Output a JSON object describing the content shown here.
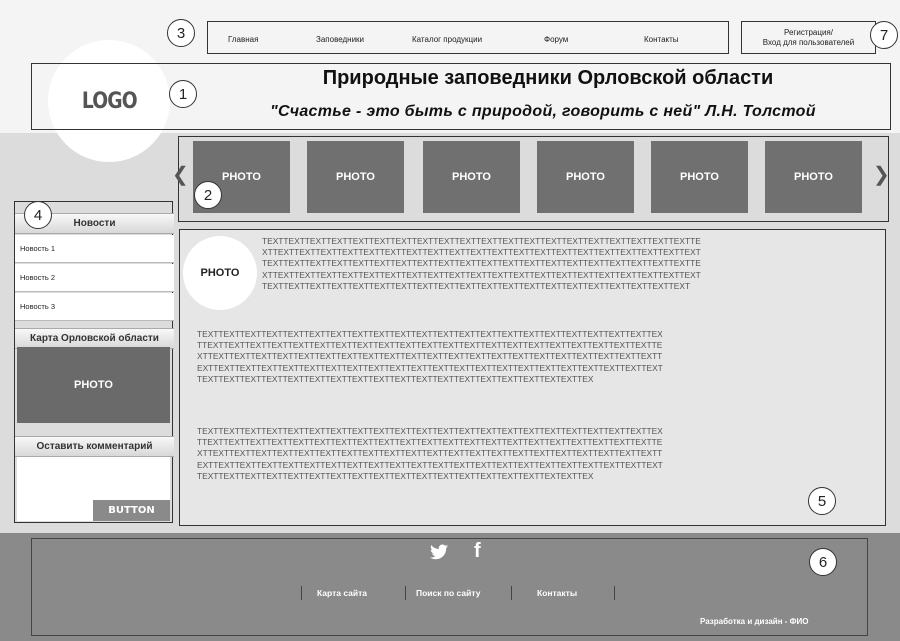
{
  "nav": {
    "items": [
      "Главная",
      "Заповедники",
      "Каталог продукции",
      "Форум",
      "Контакты"
    ],
    "login": [
      "Регистрация/",
      "Вход для пользователей"
    ]
  },
  "markers": [
    "1",
    "2",
    "3",
    "4",
    "5",
    "6",
    "7"
  ],
  "header": {
    "logo": "LOGO",
    "title": "Природные заповедники Орловской области",
    "quote": "\"Счастье - это быть с природой, говорить с ней\" Л.Н. Толстой"
  },
  "gallery": {
    "photos": [
      "PHOTO",
      "PHOTO",
      "PHOTO",
      "PHOTO",
      "PHOTO",
      "PHOTO"
    ],
    "prev_arrow": "❮",
    "next_arrow": "❯"
  },
  "sidebar": {
    "news_heading": "Новости",
    "news_items": [
      "Новость 1",
      "Новость 2",
      "Новость 3"
    ],
    "map_heading": "Карта Орловской области",
    "map_photo": "PHOTO",
    "comment_heading": "Оставить комментарий",
    "button": "BUTTON"
  },
  "content": {
    "photo": "PHOTO",
    "para1_lines": [
      "TEXTTEXTTEXTTEXTTEXTTEXTTEXTTEXTTEXTTEXTTEXTTEXTTEXTTEXTTEXTTEXTTEXTTEXTTEXTTEXTTE",
      "XTTEXTTEXTTEXTTEXTTEXTTEXTTEXTTEXTTEXTTEXTTEXTTEXTTEXTTEXTTEXTTEXTTEXTTEXTTEXTTEXT",
      "TEXTTEXTTEXTTEXTTEXTTEXTTEXTTEXTTEXTTEXTTEXTTEXTTEXTTEXTTEXTTEXTTEXTTEXTTEXTTEXTTE",
      "XTTEXTTEXTTEXTTEXTTEXTTEXTTEXTTEXTTEXTTEXTTEXTTEXTTEXTTEXTTEXTTEXTTEXTTEXTTEXTTEXT",
      "TEXTTEXTTEXTTEXTTEXTTEXTTEXTTEXTTEXTTEXTTEXTTEXTTEXTTEXTTEXTTEXTTEXTTEXTTEXTTEXT"
    ],
    "para2_lines": [
      "TEXTTEXTTEXTTEXTTEXTTEXTTEXTTEXTTEXTTEXTTEXTTEXTTEXTTEXTTEXTTEXTTEXTTEXTTEXTTEXTTEXTTEX",
      "TTEXTTEXTTEXTTEXTTEXTTEXTTEXTTEXTTEXTTEXTTEXTTEXTTEXTTEXTTEXTTEXTTEXTTEXTTEXTTEXTTEXTTE",
      "XTTEXTTEXTTEXTTEXTTEXTTEXTTEXTTEXTTEXTTEXTTEXTTEXTTEXTTEXTTEXTTEXTTEXTTEXTTEXTTEXTTEXTT",
      "EXTTEXTTEXTTEXTTEXTTEXTTEXTTEXTTEXTTEXTTEXTTEXTTEXTTEXTTEXTTEXTTEXTTEXTTEXTTEXTTEXTTEXT",
      "TEXTTEXTTEXTTEXTTEXTTEXTTEXTTEXTTEXTTEXTTEXTTEXTTEXTTEXTTEXTTEXTTEXTEXTTEX"
    ],
    "para3_lines": [
      "TEXTTEXTTEXTTEXTTEXTTEXTTEXTTEXTTEXTTEXTTEXTTEXTTEXTTEXTTEXTTEXTTEXTTEXTTEXTTEXTTEXTTEX",
      "TTEXTTEXTTEXTTEXTTEXTTEXTTEXTTEXTTEXTTEXTTEXTTEXTTEXTTEXTTEXTTEXTTEXTTEXTTEXTTEXTTEXTTE",
      "XTTEXTTEXTTEXTTEXTTEXTTEXTTEXTTEXTTEXTTEXTTEXTTEXTTEXTTEXTTEXTTEXTTEXTTEXTTEXTTEXTTEXTT",
      "EXTTEXTTEXTTEXTTEXTTEXTTEXTTEXTTEXTTEXTTEXTTEXTTEXTTEXTTEXTTEXTTEXTTEXTTEXTTEXTTEXTTEXT",
      "TEXTTEXTTEXTTEXTTEXTTEXTTEXTTEXTTEXTTEXTTEXTTEXTTEXTTEXTTEXTTEXTTEXTEXTTEX"
    ]
  },
  "footer": {
    "twitter_glyph": "🐦",
    "facebook_glyph": "f",
    "links": [
      "Карта сайта",
      "Поиск по сайту",
      "Контакты"
    ],
    "credits": "Разработка и дизайн - ФИО"
  },
  "icons": [
    "twitter-icon",
    "facebook-icon",
    "chevron-left-icon",
    "chevron-right-icon"
  ]
}
